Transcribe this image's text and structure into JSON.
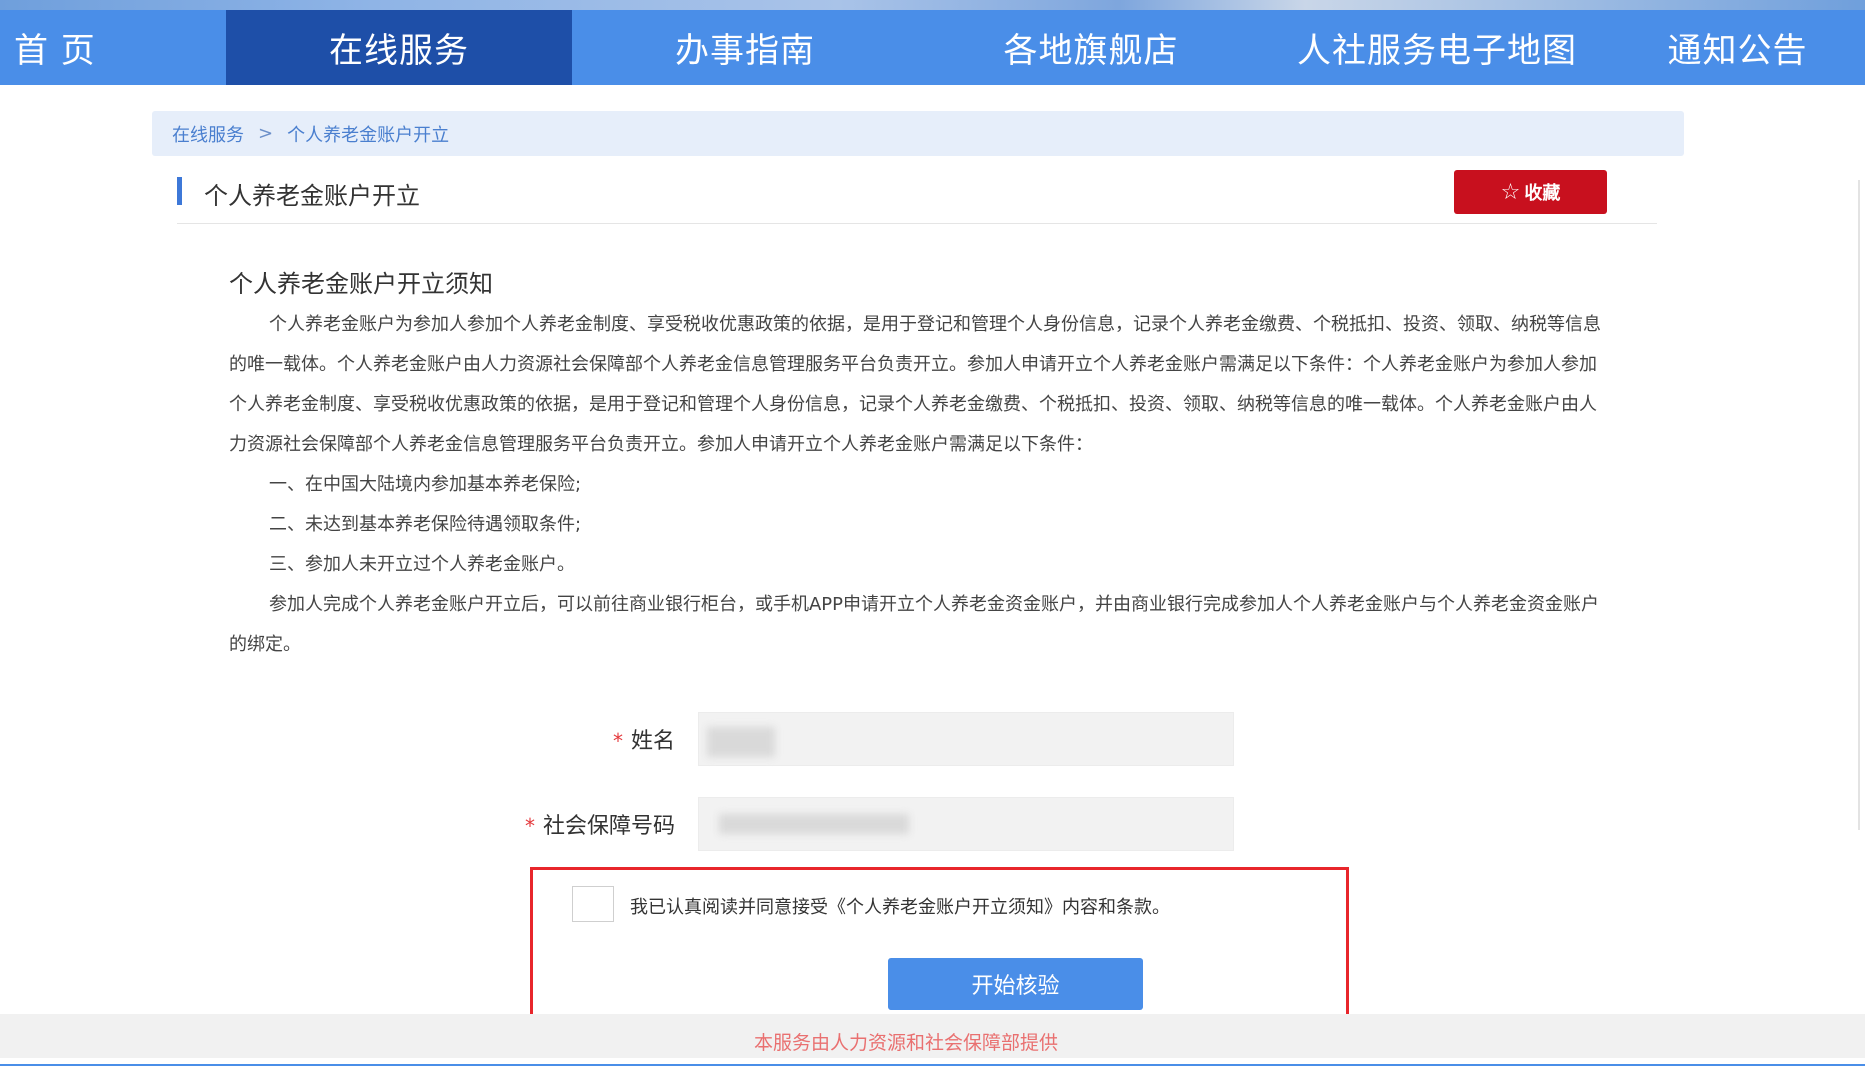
{
  "nav": {
    "items": [
      {
        "label": "首 页"
      },
      {
        "label": "在线服务"
      },
      {
        "label": "办事指南"
      },
      {
        "label": "各地旗舰店"
      },
      {
        "label": "人社服务电子地图"
      },
      {
        "label": "通知公告"
      }
    ],
    "active": "在线服务"
  },
  "breadcrumb": {
    "parent": "在线服务",
    "separator": ">",
    "current": "个人养老金账户开立"
  },
  "page": {
    "title": "个人养老金账户开立",
    "favorite_label": "收藏",
    "favorite_icon": "star-icon"
  },
  "notice": {
    "heading": "个人养老金账户开立须知",
    "paragraph1": "个人养老金账户为参加人参加个人养老金制度、享受税收优惠政策的依据，是用于登记和管理个人身份信息，记录个人养老金缴费、个税抵扣、投资、领取、纳税等信息的唯一载体。个人养老金账户由人力资源社会保障部个人养老金信息管理服务平台负责开立。参加人申请开立个人养老金账户需满足以下条件：个人养老金账户为参加人参加个人养老金制度、享受税收优惠政策的依据，是用于登记和管理个人身份信息，记录个人养老金缴费、个税抵扣、投资、领取、纳税等信息的唯一载体。个人养老金账户由人力资源社会保障部个人养老金信息管理服务平台负责开立。参加人申请开立个人养老金账户需满足以下条件：",
    "item1": "一、在中国大陆境内参加基本养老保险;",
    "item2": "二、未达到基本养老保险待遇领取条件;",
    "item3": "三、参加人未开立过个人养老金账户。",
    "paragraph2": "参加人完成个人养老金账户开立后，可以前往商业银行柜台，或手机APP申请开立个人养老金资金账户，并由商业银行完成参加人个人养老金账户与个人养老金资金账户的绑定。"
  },
  "form": {
    "required_mark": "*",
    "name_label": "姓名",
    "ssn_label": "社会保障号码",
    "agree_text": "我已认真阅读并同意接受《个人养老金账户开立须知》内容和条款。",
    "agree_checked": false,
    "submit_label": "开始核验"
  },
  "footer": {
    "provider": "本服务由人力资源和社会保障部提供"
  },
  "colors": {
    "nav": "#4a8ee8",
    "nav_active": "#1e4fa8",
    "favorite": "#c8101e",
    "highlight_box": "#e8262b"
  }
}
